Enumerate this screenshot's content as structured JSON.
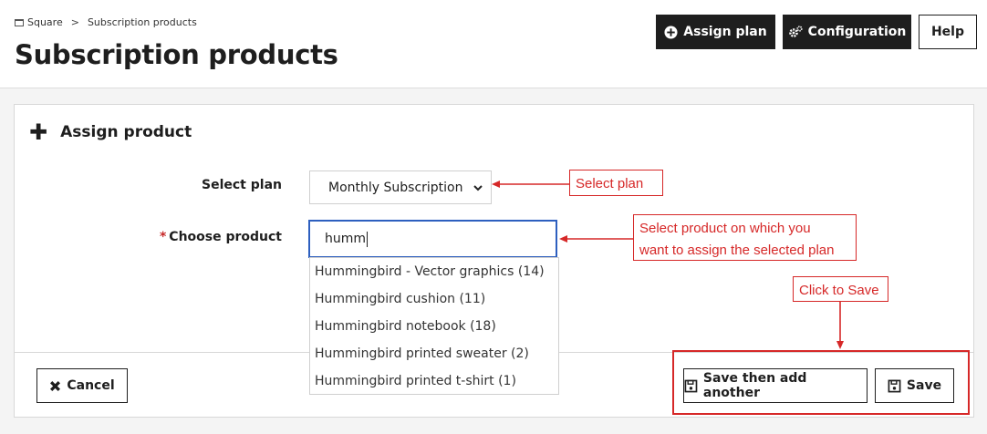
{
  "breadcrumb": {
    "root": "Square",
    "sep": ">",
    "current": "Subscription products"
  },
  "page_title": "Subscription products",
  "toolbar": {
    "assign_plan": "Assign plan",
    "configuration": "Configuration",
    "help": "Help"
  },
  "panel": {
    "heading": "Assign product",
    "select_plan_label": "Select plan",
    "select_plan_value": "Monthly Subscription",
    "required_mark": "*",
    "choose_product_label": "Choose product",
    "choose_product_value": "humm",
    "suggestions": [
      "Hummingbird - Vector graphics (14)",
      "Hummingbird cushion (11)",
      "Hummingbird notebook (18)",
      "Hummingbird printed sweater (2)",
      "Hummingbird printed t-shirt (1)"
    ]
  },
  "footer": {
    "cancel": "Cancel",
    "save_add": "Save then add another",
    "save": "Save"
  },
  "annotations": {
    "select_plan": "Select plan",
    "select_product_line1": "Select product on which you",
    "select_product_line2": "want to assign the selected plan",
    "click_save": "Click to Save"
  },
  "colors": {
    "annotation": "#d62828",
    "dark_button": "#1e1e1e",
    "input_focus": "#2d5fbf"
  }
}
